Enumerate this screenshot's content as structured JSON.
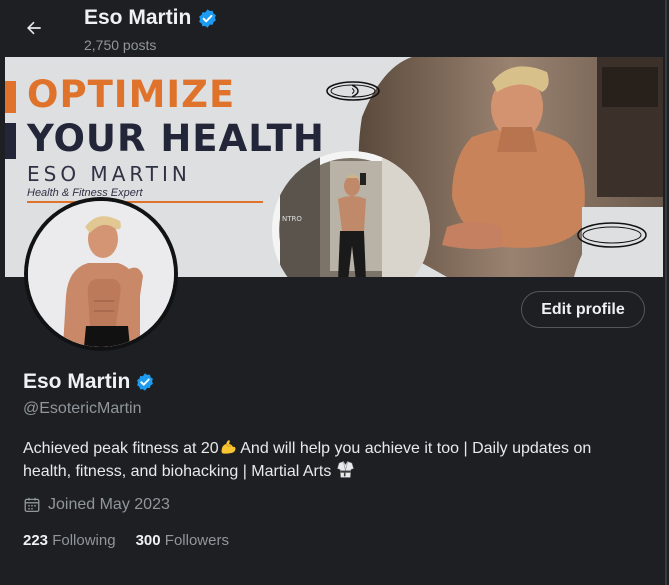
{
  "header": {
    "name": "Eso Martin",
    "posts": "2,750 posts"
  },
  "banner": {
    "line1": "OPTIMIZE",
    "line2": "YOUR HEALTH",
    "name": "ESO MARTIN",
    "subtitle": "Health & Fitness Expert"
  },
  "profile": {
    "edit_label": "Edit profile",
    "name": "Eso Martin",
    "handle": "@EsotericMartin",
    "bio_part1": "Achieved peak fitness at 20",
    "bio_part2": " And will help you achieve it too | Daily updates on health, fitness, and biohacking | Martial Arts ",
    "joined": "Joined May 2023",
    "following_count": "223",
    "following_label": "Following",
    "followers_count": "300",
    "followers_label": "Followers"
  },
  "colors": {
    "background": "#1e1f22",
    "verified": "#1d9bf0",
    "banner_orange": "#e0732c",
    "banner_navy": "#232639"
  },
  "icons": [
    "back-arrow-icon",
    "verified-badge-icon",
    "calendar-icon",
    "flexed-biceps-emoji",
    "martial-arts-uniform-emoji"
  ]
}
